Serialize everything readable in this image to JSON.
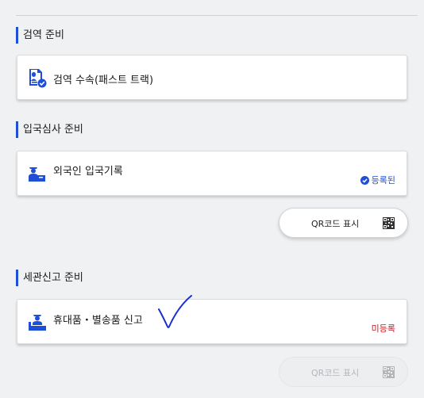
{
  "sections": [
    {
      "title": "검역 준비",
      "card": {
        "label": "검역 수속(패스트 트랙)",
        "icon": "quarantine-document-check-icon"
      }
    },
    {
      "title": "입국심사 준비",
      "card": {
        "label": "외국인 입국기록",
        "icon": "immigration-officer-icon",
        "status": "등록된",
        "status_color": "#1f4fd6"
      },
      "qr_button": {
        "label": "QR코드 표시",
        "enabled": true
      }
    },
    {
      "title": "세관신고 준비",
      "card": {
        "label": "휴대품・별송품 신고",
        "icon": "customs-officer-icon",
        "status": "미등록",
        "status_color": "#c0202a"
      },
      "qr_button": {
        "label": "QR코드 표시",
        "enabled": false
      }
    }
  ],
  "colors": {
    "accent": "#1f4fd6",
    "unregistered": "#c0202a",
    "annotation": "#1a2fd0"
  }
}
